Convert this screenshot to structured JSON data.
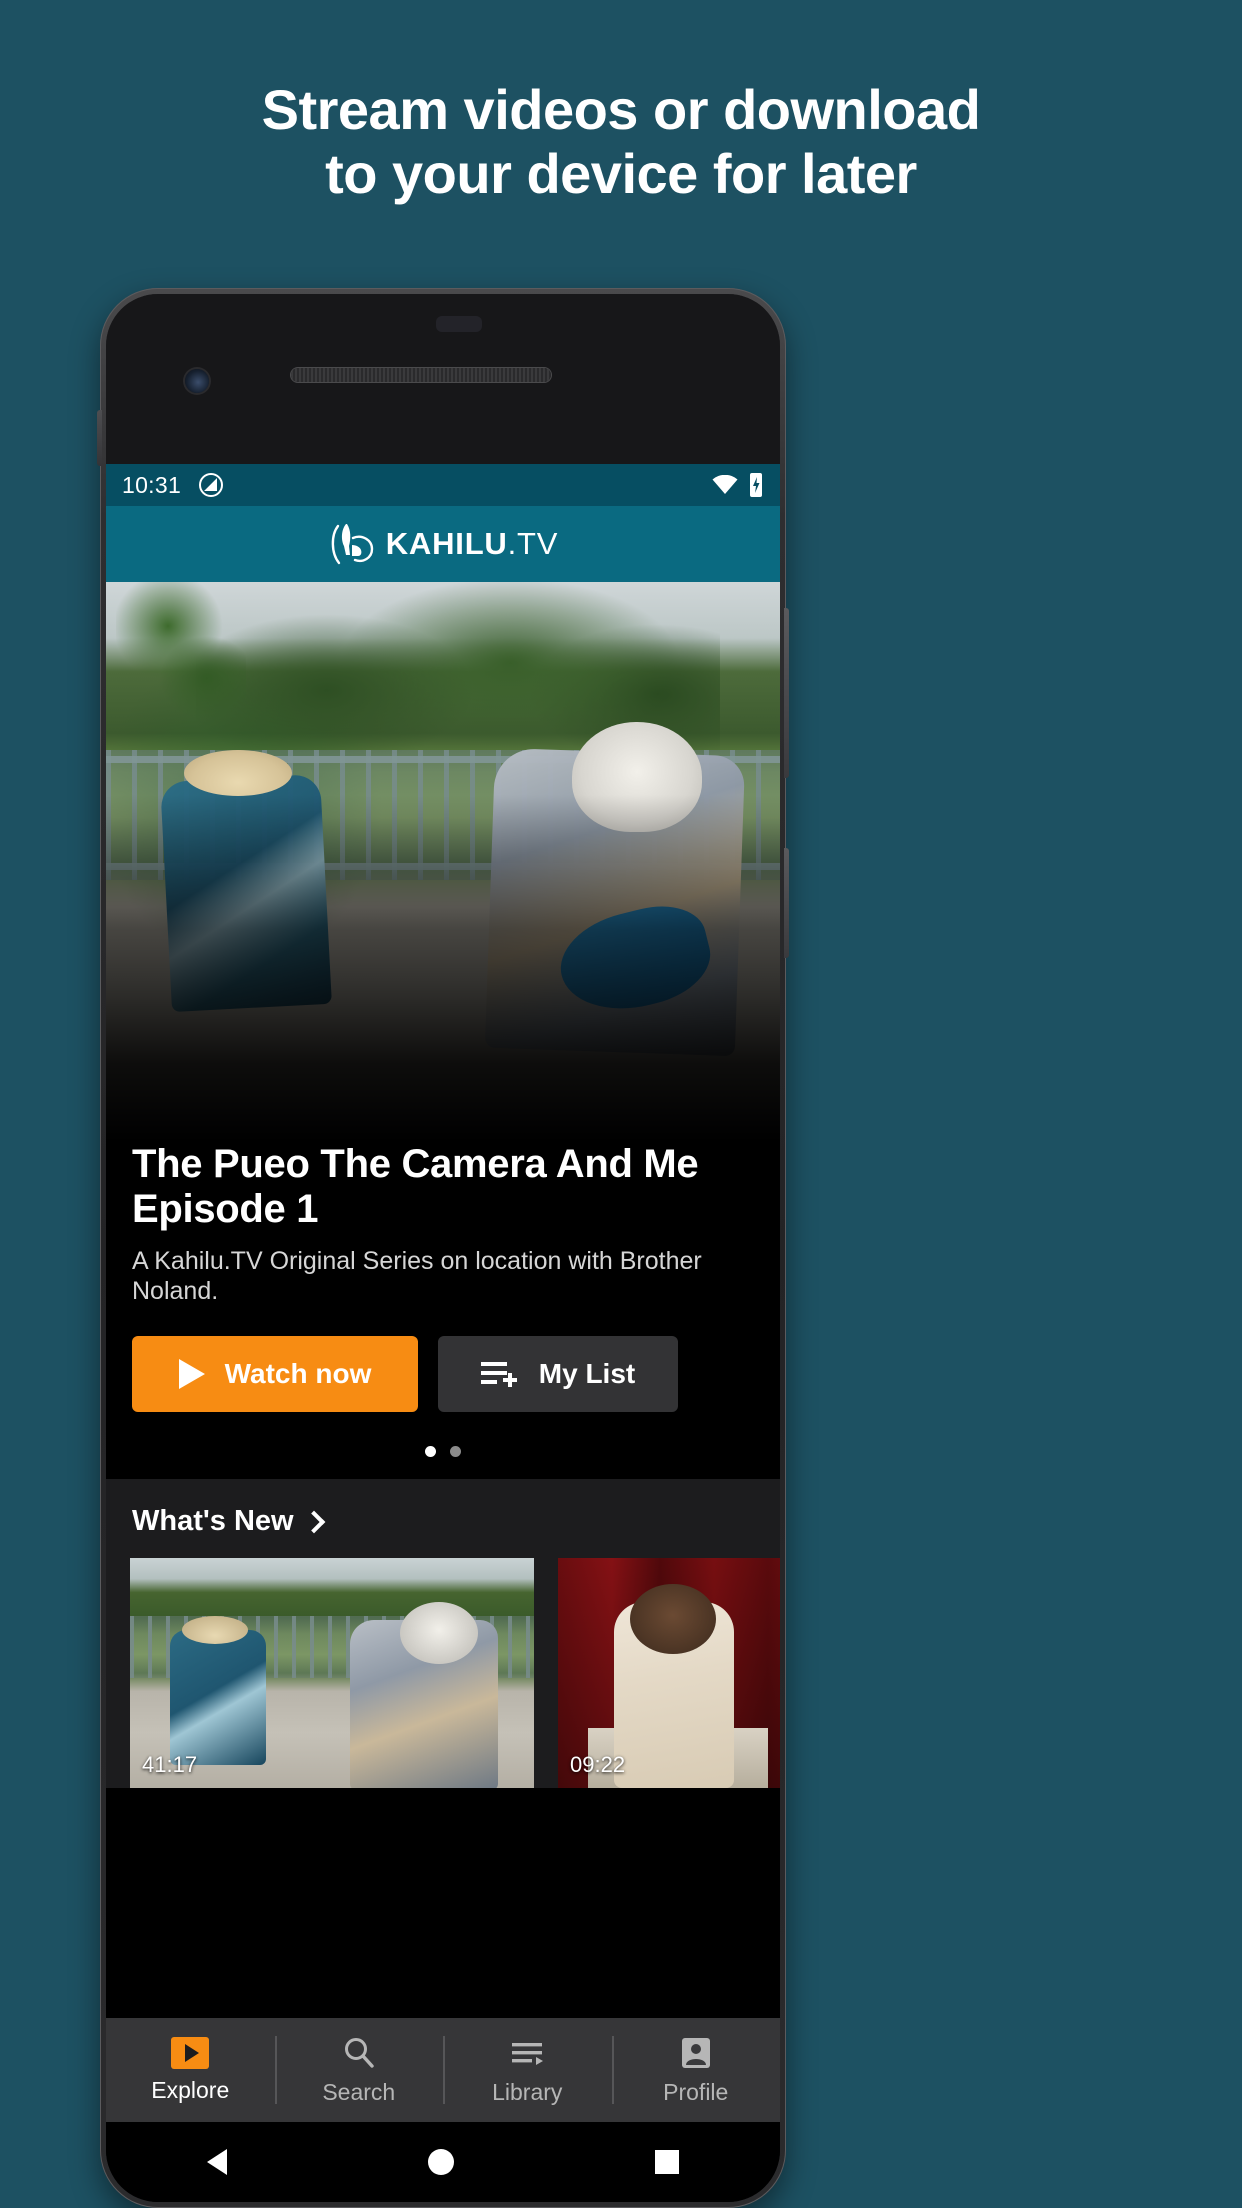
{
  "promo": {
    "headline_line1": "Stream videos or download",
    "headline_line2": "to your device for later",
    "bg_color": "#1d5162"
  },
  "status_bar": {
    "time": "10:31",
    "rotation_icon": "rotation-lock-icon",
    "wifi_icon": "wifi-icon",
    "battery_icon": "battery-charging-icon",
    "bg_color": "#064e62"
  },
  "app_header": {
    "logo_icon": "kahilu-logo-icon",
    "brand": "KAHILU",
    "brand_suffix": ".TV",
    "bg_color": "#0a6a81"
  },
  "hero": {
    "title_line1": "The Pueo The Camera And Me",
    "title_line2": "Episode 1",
    "subtitle": "A Kahilu.TV Original Series on location with Brother Noland.",
    "watch_button": "Watch now",
    "watch_button_color": "#f78c13",
    "mylist_button": "My List",
    "mylist_button_color": "#333335",
    "pager": {
      "total": 2,
      "active_index": 0
    }
  },
  "whats_new": {
    "title": "What's New",
    "chevron_icon": "chevron-right-icon",
    "cards": [
      {
        "duration": "41:17"
      },
      {
        "duration": "09:22"
      }
    ]
  },
  "bottom_nav": {
    "items": [
      {
        "label": "Explore",
        "icon": "explore-play-icon",
        "active": true
      },
      {
        "label": "Search",
        "icon": "search-icon",
        "active": false
      },
      {
        "label": "Library",
        "icon": "library-icon",
        "active": false
      },
      {
        "label": "Profile",
        "icon": "profile-icon",
        "active": false
      }
    ]
  },
  "system_nav": {
    "back": "back-triangle-icon",
    "home": "home-circle-icon",
    "recents": "recents-square-icon"
  }
}
